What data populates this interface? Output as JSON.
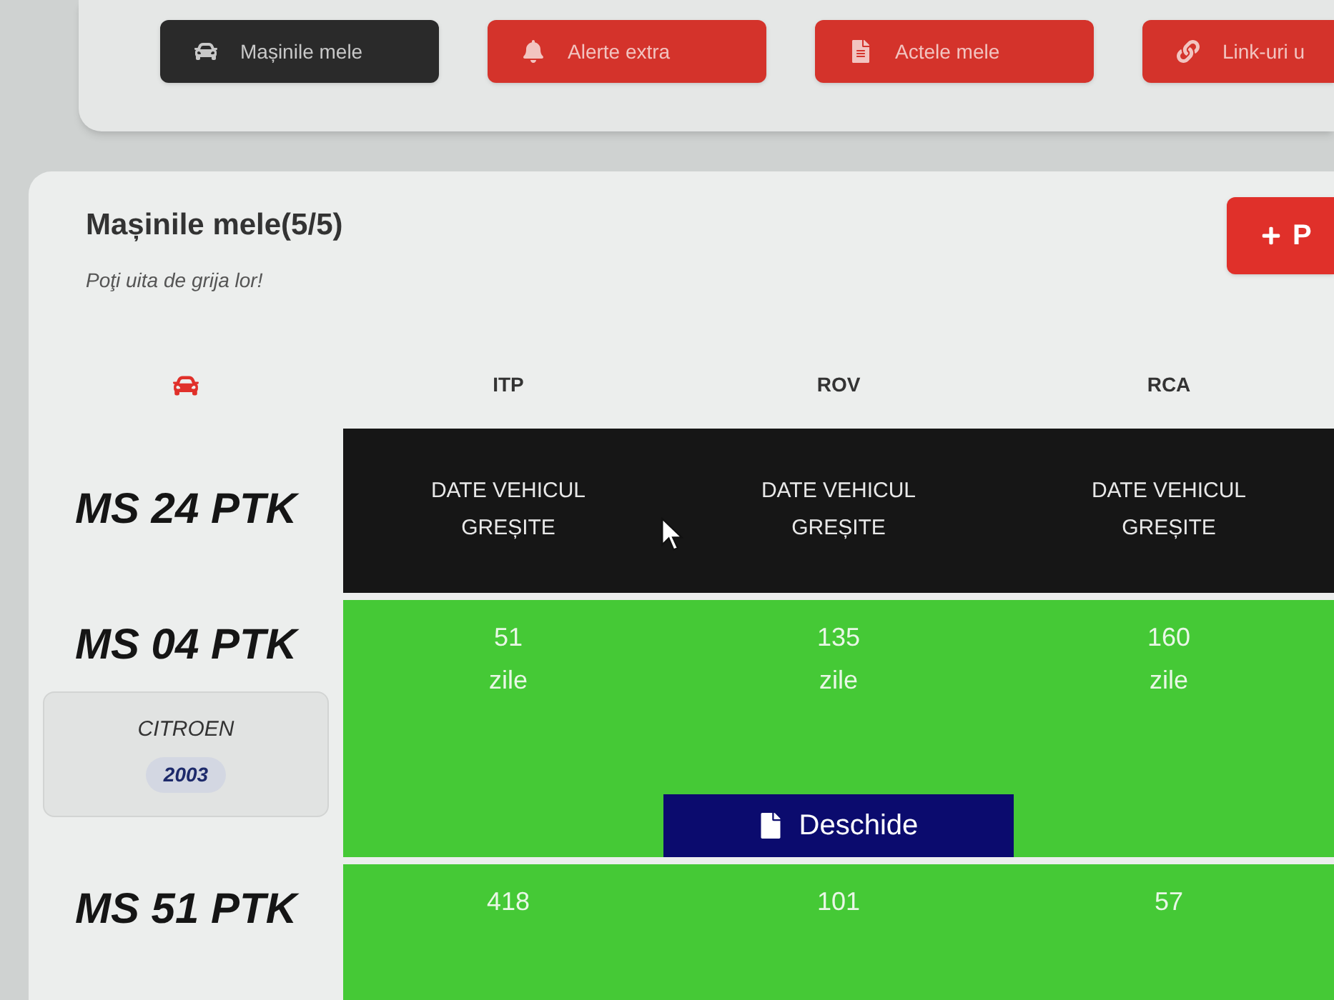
{
  "nav": {
    "buttons": [
      {
        "label": "Mașinile mele",
        "selected": true
      },
      {
        "label": "Alerte extra",
        "selected": false
      },
      {
        "label": "Actele mele",
        "selected": false
      },
      {
        "label": "Link-uri u",
        "selected": false
      }
    ]
  },
  "cars_panel": {
    "title": "Mașinile mele(5/5)",
    "subtitle": "Poţi uita de grija lor!",
    "add_button": {
      "label": "P"
    }
  },
  "table": {
    "columns": [
      "ITP",
      "ROV",
      "RCA"
    ],
    "rows": [
      {
        "plate": "MS 24 PTK",
        "kind": "error",
        "cells": [
          {
            "text": "DATE VEHICUL GREȘITE"
          },
          {
            "text": "DATE VEHICUL GREȘITE"
          },
          {
            "text": "DATE VEHICUL GREȘITE"
          }
        ]
      },
      {
        "plate": "MS 04 PTK",
        "kind": "valid",
        "vehicle": {
          "make": "CITROEN",
          "year": "2003"
        },
        "cells": [
          {
            "days": "51",
            "unit": "zile"
          },
          {
            "days": "135",
            "unit": "zile"
          },
          {
            "days": "160",
            "unit": "zile"
          }
        ],
        "action": {
          "label": "Deschide"
        }
      },
      {
        "plate": "MS 51 PTK",
        "kind": "valid",
        "cells": [
          {
            "days": "418"
          },
          {
            "days": "101"
          },
          {
            "days": "57"
          }
        ]
      }
    ]
  }
}
